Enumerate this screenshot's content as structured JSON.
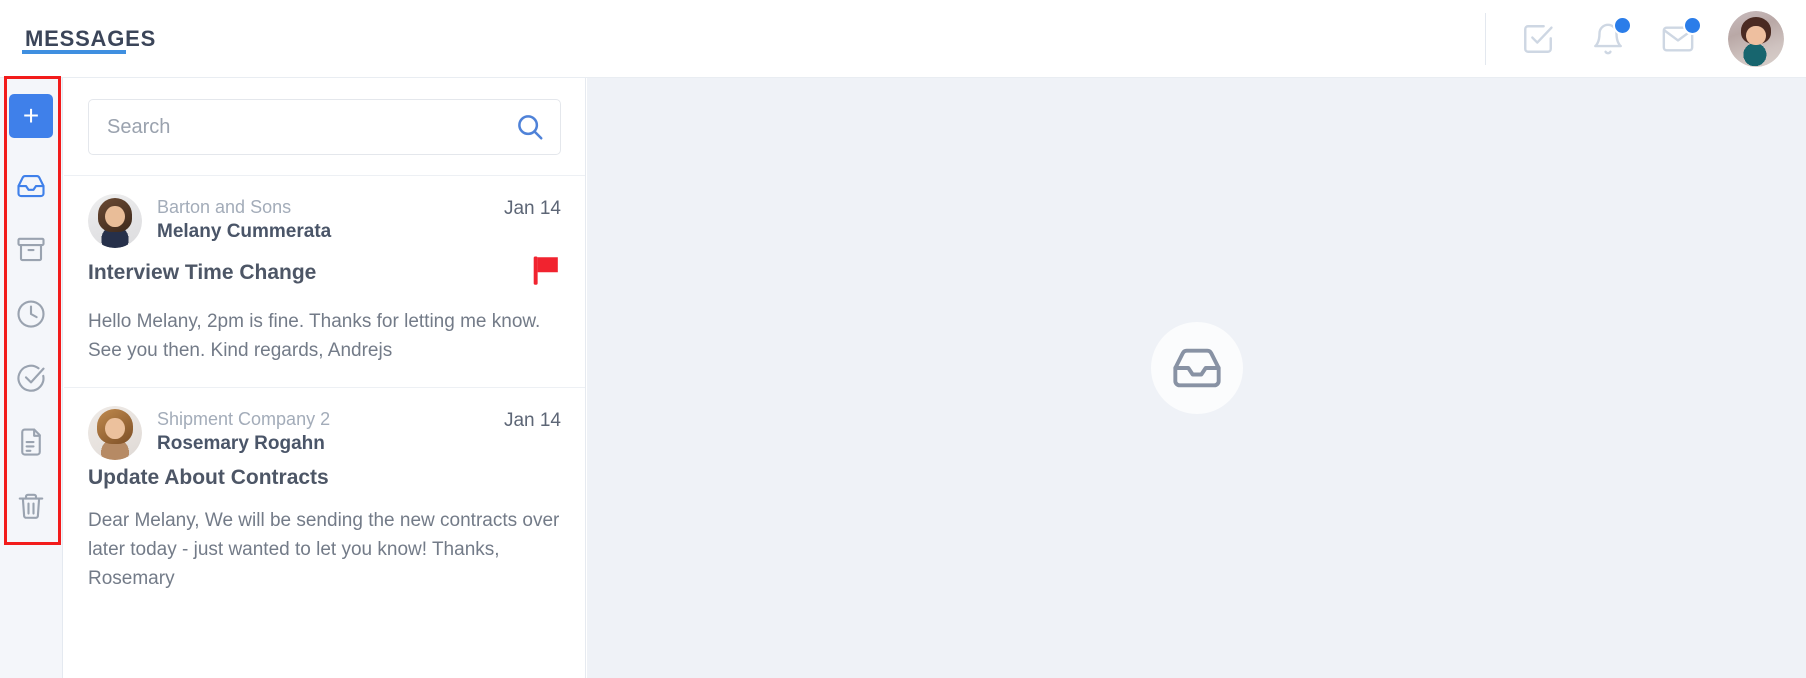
{
  "header": {
    "title": "MESSAGES",
    "icons": [
      {
        "name": "tasks-icon",
        "badge": false
      },
      {
        "name": "bell-icon",
        "badge": true
      },
      {
        "name": "envelope-icon",
        "badge": true
      }
    ],
    "avatar_label": "user-avatar",
    "accent_color": "#3f80ea",
    "badge_color": "#2b7de9"
  },
  "sidebar": {
    "compose_label": "+",
    "items": [
      {
        "icon": "inbox-icon",
        "label": "Inbox",
        "active": true
      },
      {
        "icon": "archive-icon",
        "label": "Archive",
        "active": false
      },
      {
        "icon": "clock-icon",
        "label": "Snoozed",
        "active": false
      },
      {
        "icon": "check-circle-icon",
        "label": "Done",
        "active": false
      },
      {
        "icon": "document-icon",
        "label": "Drafts",
        "active": false
      },
      {
        "icon": "trash-icon",
        "label": "Trash",
        "active": false
      }
    ],
    "highlight_color": "#f21b1b"
  },
  "search": {
    "placeholder": "Search",
    "value": "",
    "icon": "search-icon"
  },
  "messages": [
    {
      "company": "Barton and Sons",
      "sender": "Melany Cummerata",
      "date": "Jan 14",
      "subject": "Interview Time Change",
      "preview": "Hello Melany, 2pm is fine. Thanks for letting me know. See you then. Kind regards, Andrejs",
      "flagged": true,
      "flag_color": "#f1232f"
    },
    {
      "company": "Shipment Company 2",
      "sender": "Rosemary Rogahn",
      "date": "Jan 14",
      "subject": "Update About Contracts",
      "preview": "Dear Melany, We will be sending the new contracts over later today - just wanted to let you know! Thanks, Rosemary",
      "flagged": false,
      "flag_color": "#f1232f"
    }
  ],
  "main": {
    "empty_icon": "inbox-icon",
    "background_color": "#eff2f7"
  }
}
